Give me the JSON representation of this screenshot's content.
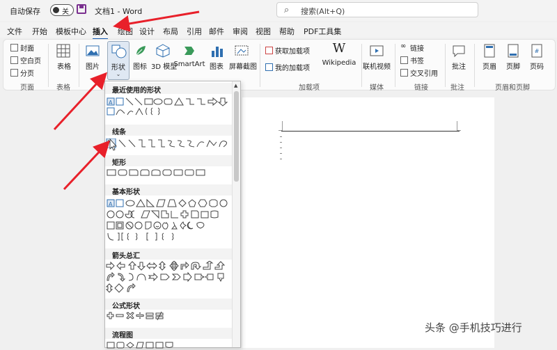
{
  "titlebar": {
    "autosave": "自动保存",
    "toggle_state": "关",
    "doc_title": "文档1 - Word",
    "search_placeholder": "搜索(Alt+Q)"
  },
  "tabs": [
    "文件",
    "开始",
    "模板中心",
    "插入",
    "绘图",
    "设计",
    "布局",
    "引用",
    "邮件",
    "审阅",
    "视图",
    "帮助",
    "PDF工具集"
  ],
  "active_tab": "插入",
  "ribbon": {
    "pages": {
      "cover": "封面",
      "blank": "空白页",
      "break": "分页",
      "label": "页面"
    },
    "table": {
      "btn": "表格",
      "label": "表格"
    },
    "illustrations": {
      "picture": "图片",
      "shapes": "形状",
      "icons": "图标",
      "model3d": "3D 模型",
      "smartart": "SmartArt",
      "chart": "图表",
      "screenshot": "屏幕截图"
    },
    "addins": {
      "get": "获取加载项",
      "my": "我的加载项",
      "wikipedia": "Wikipedia",
      "label": "加载项"
    },
    "media": {
      "online_video": "联机视频",
      "label": "媒体"
    },
    "links": {
      "link": "链接",
      "bookmark": "书签",
      "crossref": "交叉引用",
      "label": "链接"
    },
    "comments": {
      "comment": "批注",
      "label": "批注"
    },
    "headerfooter": {
      "header": "页眉",
      "footer": "页脚",
      "pagenum": "页码",
      "label": "页眉和页脚"
    }
  },
  "shapes_dropdown": {
    "recent": "最近使用的形状",
    "lines": "线条",
    "rect": "矩形",
    "basic": "基本形状",
    "arrows": "箭头总汇",
    "equation": "公式形状",
    "flowchart": "流程图"
  },
  "watermark": "头条 @手机技巧进行",
  "colors": {
    "accent": "#1a5fb4",
    "arrow": "#e8202a",
    "brand": "#7a2f8f"
  }
}
